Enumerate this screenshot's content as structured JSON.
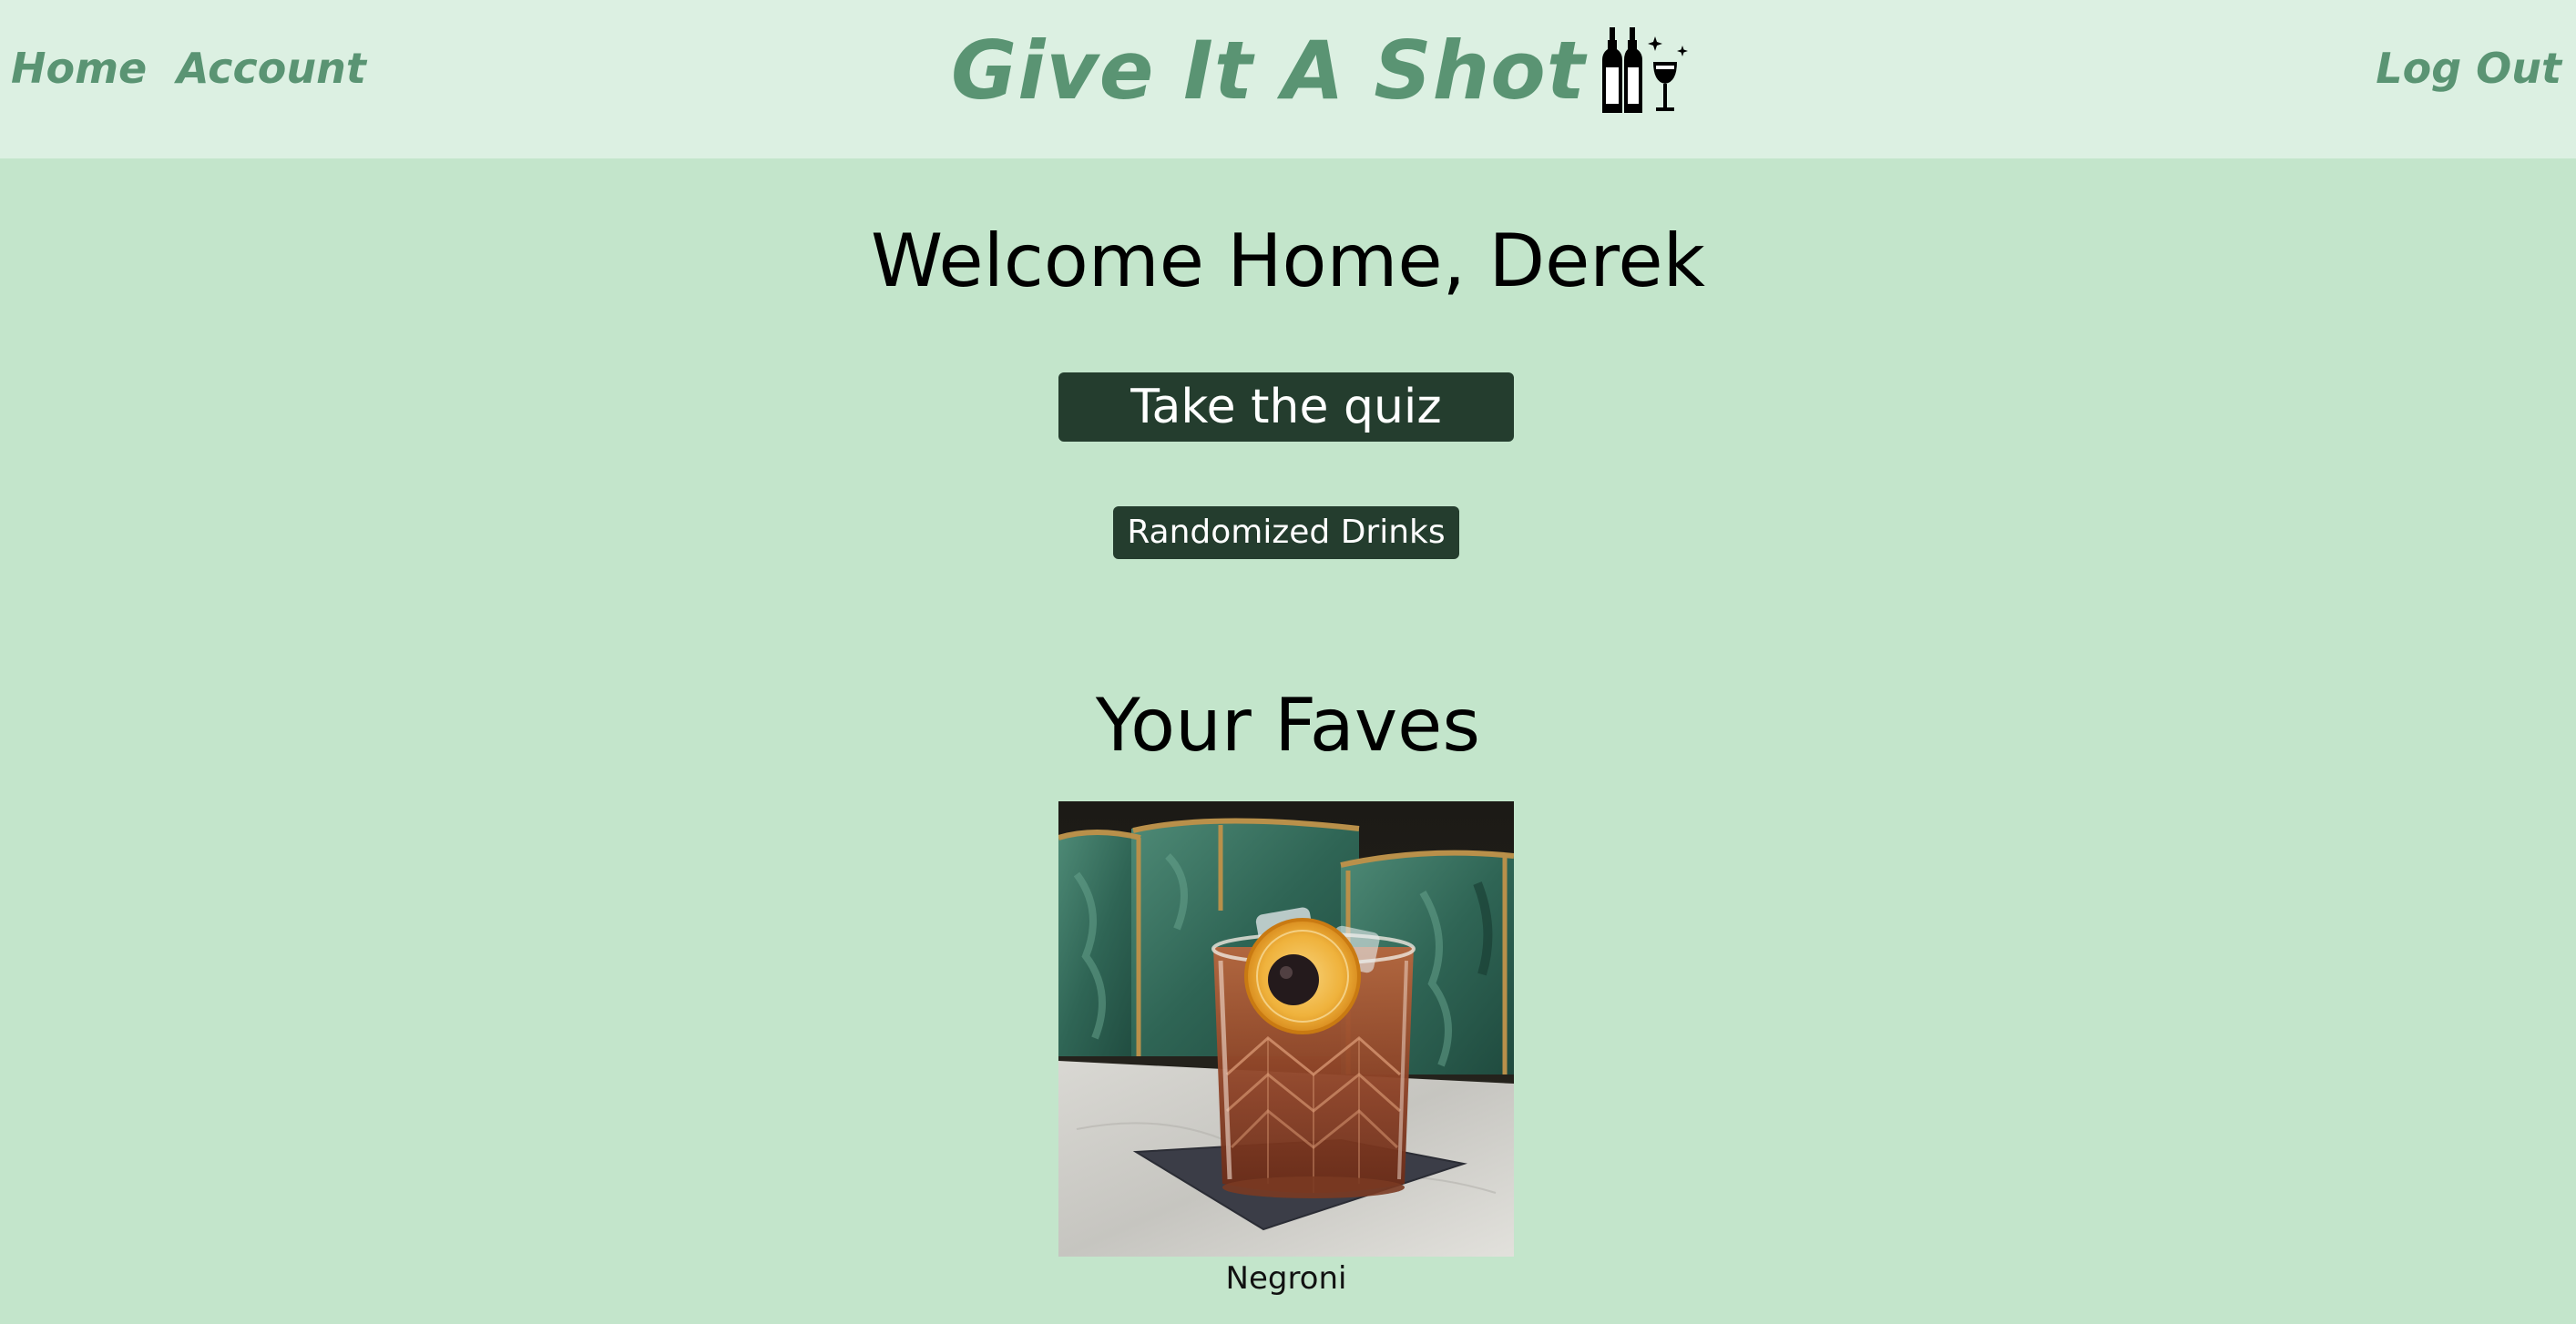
{
  "nav": {
    "home_label": "Home",
    "account_label": "Account",
    "logout_label": "Log Out"
  },
  "brand": {
    "title": "Give It A Shot",
    "icon": "bottles-and-wine-glass-icon",
    "color": "#5a9473"
  },
  "main": {
    "welcome": "Welcome Home, Derek",
    "quiz_button": "Take the quiz",
    "random_button": "Randomized Drinks",
    "faves_title": "Your Faves"
  },
  "faves": [
    {
      "name": "Negroni",
      "image": "negroni-cocktail-photo"
    }
  ],
  "colors": {
    "page_background": "#c3e5cb",
    "navbar_background": "#dcf0e2",
    "button_background": "#243d2e",
    "button_text": "#ffffff"
  }
}
